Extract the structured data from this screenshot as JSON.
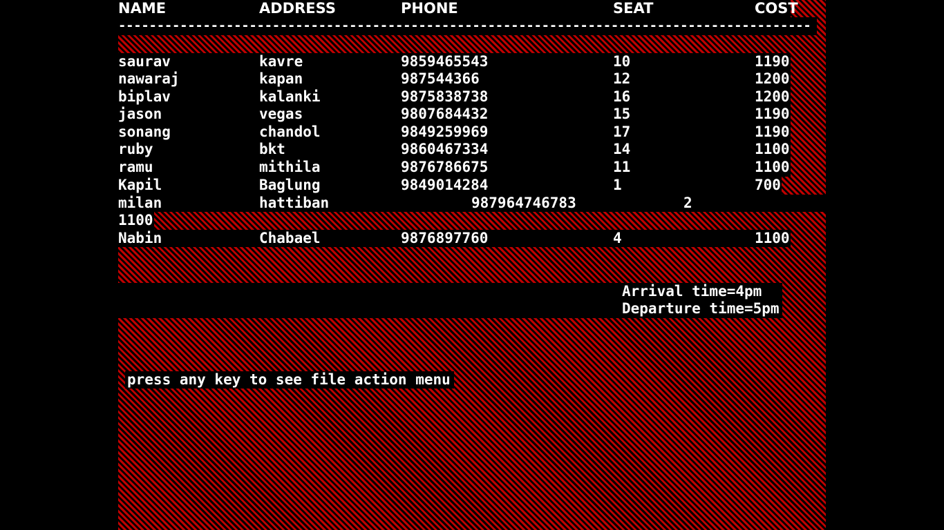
{
  "colors": {
    "background": "#000000",
    "pattern": "#c00000",
    "text": "#ffffff"
  },
  "header": {
    "name": "NAME",
    "address": "ADDRESS",
    "phone": "PHONE",
    "seat": "SEAT",
    "cost": "COST",
    "divider": "------------------------------------------------------------------------------------------"
  },
  "rows": [
    {
      "name": "saurav",
      "address": "kavre",
      "phone": "9859465543",
      "seat": "10",
      "cost": "1190"
    },
    {
      "name": "nawaraj",
      "address": "kapan",
      "phone": "987544366",
      "seat": "12",
      "cost": "1200"
    },
    {
      "name": "biplav",
      "address": "kalanki",
      "phone": "9875838738",
      "seat": "16",
      "cost": "1200"
    },
    {
      "name": "jason",
      "address": "vegas",
      "phone": "9807684432",
      "seat": "15",
      "cost": "1190"
    },
    {
      "name": "sonang",
      "address": "chandol",
      "phone": "9849259969",
      "seat": "17",
      "cost": "1190"
    },
    {
      "name": "ruby",
      "address": "bkt",
      "phone": "9860467334",
      "seat": "14",
      "cost": "1100"
    },
    {
      "name": "ramu",
      "address": "mithila",
      "phone": "9876786675",
      "seat": "11",
      "cost": "1100"
    },
    {
      "name": "Kapil",
      "address": "Baglung",
      "phone": "9849014284",
      "seat": "1",
      "cost": "700"
    }
  ],
  "overflow_row": {
    "name": "milan",
    "address": "hattiban",
    "phone": "987964746783",
    "seat": "2",
    "cost": "1100"
  },
  "last_row": {
    "name": "Nabin",
    "address": "Chabael",
    "phone": "9876897760",
    "seat": "4",
    "cost": "1100"
  },
  "schedule": {
    "arrival": "Arrival time=4pm",
    "departure": "Departure time=5pm"
  },
  "prompt": "press any key to see file action menu"
}
